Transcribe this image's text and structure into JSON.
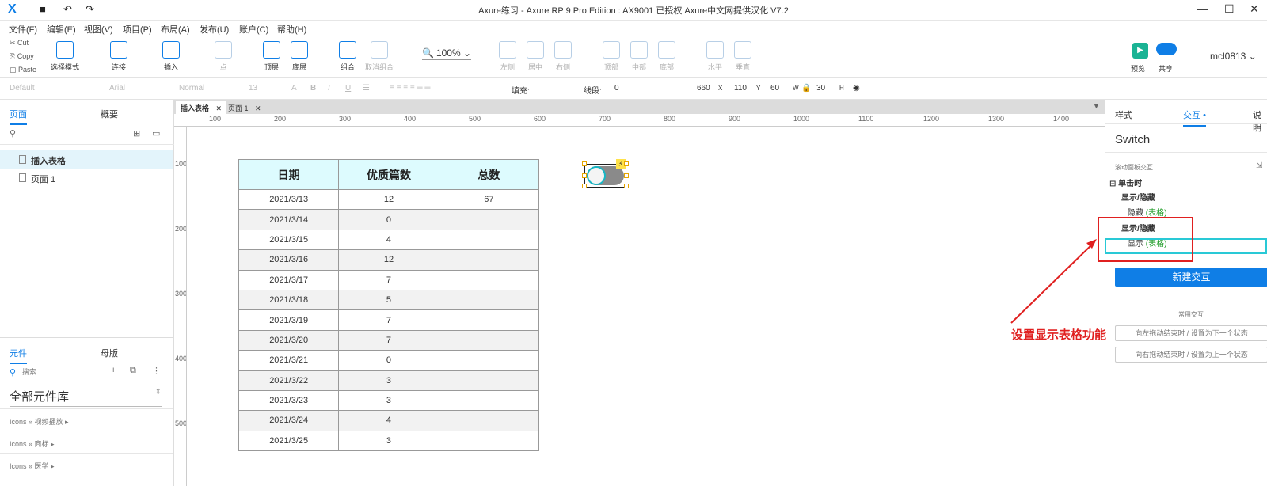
{
  "titlebar": {
    "title": "Axure练习 - Axure RP 9 Pro Edition : AX9001 已授权    Axure中文网提供汉化 V7.2",
    "logo": "X"
  },
  "menu": [
    "文件(F)",
    "编辑(E)",
    "视图(V)",
    "项目(P)",
    "布局(A)",
    "发布(U)",
    "账户(C)",
    "帮助(H)"
  ],
  "clipboard": [
    "Cut",
    "Copy",
    "Paste"
  ],
  "toolbar": {
    "select_mode": "选择模式",
    "connect": "连接",
    "insert": "插入",
    "point": "点",
    "top_layer": "顶层",
    "bottom_layer": "底层",
    "group": "组合",
    "ungroup": "取消组合",
    "zoom": "100%",
    "align_left": "左侧",
    "align_center": "居中",
    "align_right": "右侧",
    "align_top": "顶部",
    "align_middle": "中部",
    "align_bottom": "底部",
    "dist_horizontal": "水平",
    "dist_vertical": "垂直",
    "preview": "预览",
    "share": "共享",
    "user": "mcl0813"
  },
  "formatbar": {
    "style": "Default",
    "font": "Arial",
    "weight": "Normal",
    "size": "13",
    "fill_label": "填充:",
    "line_label": "线段:",
    "line_value": "0",
    "x": "660",
    "y": "110",
    "w": "60",
    "h": "30",
    "x_label": "X",
    "y_label": "Y",
    "w_label": "W",
    "h_label": "H"
  },
  "left_panel": {
    "tab_pages": "页面",
    "tab_outline": "概要",
    "pages": [
      "插入表格",
      "页面 1"
    ],
    "tab_widgets": "元件",
    "tab_masters": "母版",
    "search_placeholder": "搜索...",
    "library": "全部元件库",
    "libraries": [
      "Icons » 视频播放 ▸",
      "Icons » 商标 ▸",
      "Icons » 医学 ▸"
    ]
  },
  "doc_tabs": [
    "插入表格",
    "页面 1"
  ],
  "ruler": {
    "h": [
      "100",
      "200",
      "300",
      "400",
      "500",
      "600",
      "700",
      "800",
      "900",
      "1000",
      "1100",
      "1200",
      "1300",
      "1400"
    ],
    "v": [
      "100",
      "200",
      "300",
      "400",
      "500"
    ]
  },
  "table": {
    "headers": [
      "日期",
      "优质篇数",
      "总数"
    ],
    "rows": [
      [
        "2021/3/13",
        "12",
        "67"
      ],
      [
        "2021/3/14",
        "0",
        ""
      ],
      [
        "2021/3/15",
        "4",
        ""
      ],
      [
        "2021/3/16",
        "12",
        ""
      ],
      [
        "2021/3/17",
        "7",
        ""
      ],
      [
        "2021/3/18",
        "5",
        ""
      ],
      [
        "2021/3/19",
        "7",
        ""
      ],
      [
        "2021/3/20",
        "7",
        ""
      ],
      [
        "2021/3/21",
        "0",
        ""
      ],
      [
        "2021/3/22",
        "3",
        ""
      ],
      [
        "2021/3/23",
        "3",
        ""
      ],
      [
        "2021/3/24",
        "4",
        ""
      ],
      [
        "2021/3/25",
        "3",
        ""
      ]
    ]
  },
  "right_panel": {
    "tab_style": "样式",
    "tab_interaction": "交互",
    "tab_notes": "说明",
    "component": "Switch",
    "section_label": "滚动面板交互",
    "event": "单击时",
    "action1": "显示/隐藏",
    "action1_detail": "隐藏",
    "action1_target": "(表格)",
    "action2": "显示/隐藏",
    "action2_detail": "显示",
    "action2_target": "(表格)",
    "new_interaction": "新建交互",
    "common": "常用交互",
    "common_items": [
      "向左拖动结束时 / 设置为下一个状态",
      "向右拖动结束时 / 设置为上一个状态"
    ]
  },
  "annotation": "设置显示表格功能",
  "colors": {
    "accent": "#0f7ee6",
    "annotation": "#e02020",
    "header_fill": "#ddfbfe",
    "highlight": "#29c9d6"
  }
}
